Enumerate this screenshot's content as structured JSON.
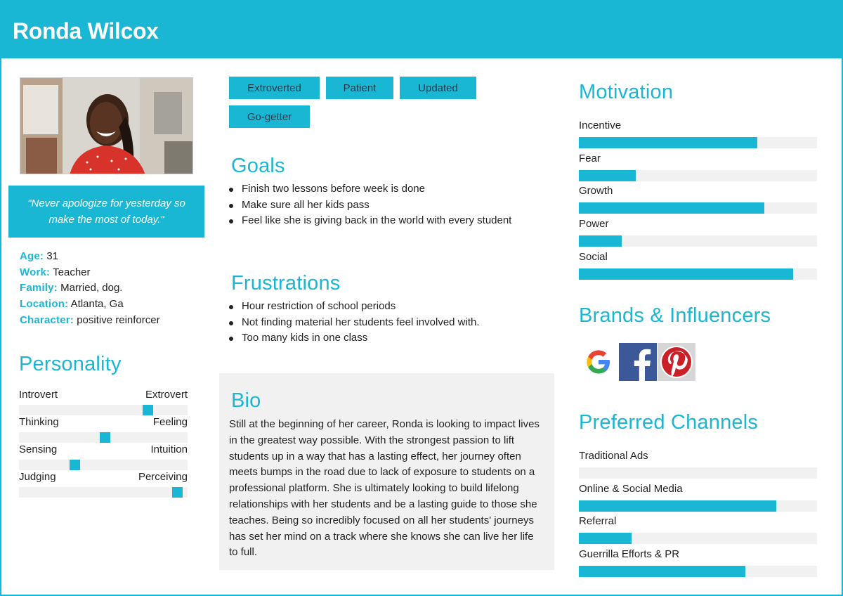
{
  "header": {
    "name": "Ronda Wilcox"
  },
  "colors": {
    "accent": "#1ab7d4",
    "track": "#f1f1f1"
  },
  "quote": "\"Never apologize for yesterday so make the most of today.\"",
  "facts": [
    {
      "key": "Age:",
      "value": "31"
    },
    {
      "key": "Work:",
      "value": "Teacher"
    },
    {
      "key": "Family:",
      "value": "Married, dog."
    },
    {
      "key": "Location:",
      "value": "Atlanta, Ga"
    },
    {
      "key": "Character:",
      "value": "positive reinforcer"
    }
  ],
  "personality": {
    "title": "Personality",
    "scales": [
      {
        "left": "Introvert",
        "right": "Extrovert",
        "value": 0.78
      },
      {
        "left": "Thinking",
        "right": "Feeling",
        "value": 0.51
      },
      {
        "left": "Sensing",
        "right": "Intuition",
        "value": 0.32
      },
      {
        "left": "Judging",
        "right": "Perceiving",
        "value": 0.97
      }
    ]
  },
  "tags": [
    "Extroverted",
    "Patient",
    "Updated",
    "Go-getter"
  ],
  "goals": {
    "title": "Goals",
    "items": [
      "Finish two lessons before week is done",
      "Make sure all her kids pass",
      "Feel like she is giving back in the world with every student"
    ]
  },
  "frustrations": {
    "title": "Frustrations",
    "items": [
      "Hour restriction of school periods",
      "Not finding material her students feel involved with.",
      "Too many kids in one class"
    ]
  },
  "bio": {
    "title": "Bio",
    "text": "Still at the beginning of her career, Ronda is looking to impact lives in the greatest way possible. With the strongest passion to lift students up in a way that has a lasting effect, her journey often meets bumps in the road due to lack of exposure to students on a professional platform. She is ultimately looking to build lifelong relationships with her students and be a lasting guide to those she teaches. Being so incredibly focused on all her students' journeys has set her mind on a track where she knows she can live her life to full."
  },
  "motivation": {
    "title": "Motivation",
    "items": [
      {
        "label": "Incentive",
        "value": 0.75
      },
      {
        "label": "Fear",
        "value": 0.24
      },
      {
        "label": "Growth",
        "value": 0.78
      },
      {
        "label": "Power",
        "value": 0.18
      },
      {
        "label": "Social",
        "value": 0.9
      }
    ]
  },
  "brands": {
    "title": "Brands & Influencers",
    "icons": [
      "google-icon",
      "facebook-icon",
      "pinterest-icon"
    ]
  },
  "channels": {
    "title": "Preferred Channels",
    "items": [
      {
        "label": "Traditional Ads",
        "value": 0.0
      },
      {
        "label": "Online & Social Media",
        "value": 0.83
      },
      {
        "label": "Referral",
        "value": 0.22
      },
      {
        "label": "Guerrilla Efforts & PR",
        "value": 0.7
      }
    ]
  }
}
